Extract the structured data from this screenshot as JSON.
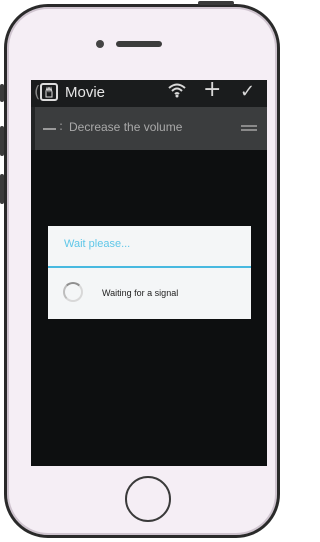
{
  "app": {
    "title": "Movie",
    "back_glyph": "(",
    "icon": "hand-icon"
  },
  "actionbar": {
    "wifi_glyph": "📶",
    "add_glyph": "+",
    "confirm_glyph": "✓"
  },
  "list": {
    "items": [
      {
        "label": "Decrease the volume",
        "dash": "—",
        "colon": ":"
      }
    ]
  },
  "dialog": {
    "title": "Wait please...",
    "message": "Waiting for a signal"
  },
  "colors": {
    "accent": "#47b9e0",
    "screen_bg": "#0f1112",
    "phone_body": "#f5eef5"
  }
}
